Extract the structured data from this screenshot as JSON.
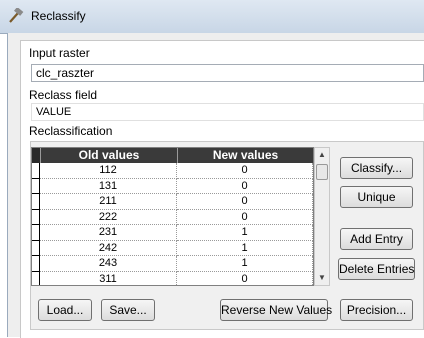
{
  "window": {
    "title": "Reclassify"
  },
  "input_raster": {
    "label": "Input raster",
    "value": "clc_raszter"
  },
  "reclass_field": {
    "label": "Reclass field",
    "value": "VALUE"
  },
  "reclassification": {
    "label": "Reclassification",
    "columns": [
      "Old values",
      "New values"
    ],
    "rows": [
      [
        "112",
        "0"
      ],
      [
        "131",
        "0"
      ],
      [
        "211",
        "0"
      ],
      [
        "222",
        "0"
      ],
      [
        "231",
        "1"
      ],
      [
        "242",
        "1"
      ],
      [
        "243",
        "1"
      ],
      [
        "311",
        "0"
      ]
    ]
  },
  "buttons": {
    "classify": "Classify...",
    "unique": "Unique",
    "add_entry": "Add Entry",
    "delete_entries": "Delete Entries",
    "load": "Load...",
    "save": "Save...",
    "reverse": "Reverse New Values",
    "precision": "Precision..."
  }
}
